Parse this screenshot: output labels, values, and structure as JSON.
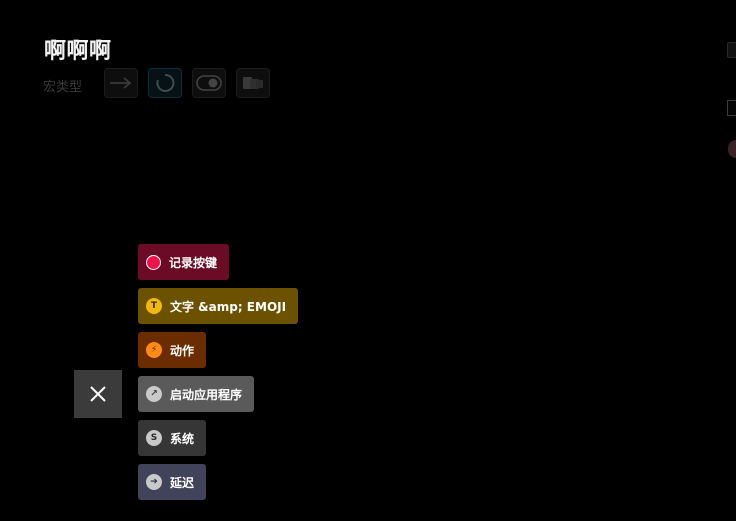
{
  "header": {
    "title": "啊啊啊",
    "macro_type_label": "宏类型",
    "type_buttons": [
      {
        "name": "arrow-right-icon",
        "active": false
      },
      {
        "name": "loop-icon",
        "active": true
      },
      {
        "name": "toggle-icon",
        "active": false
      },
      {
        "name": "cards-icon",
        "active": false
      }
    ]
  },
  "fab": {
    "close_icon": "close-icon"
  },
  "actions": [
    {
      "label": "记录按键",
      "icon": "record-icon",
      "color": "#6b0b25"
    },
    {
      "label": "文字 &amp; EMOJI",
      "icon": "text-icon",
      "icon_glyph": "T",
      "color": "#6b5100"
    },
    {
      "label": "动作",
      "icon": "lightning-icon",
      "icon_glyph": "⚡",
      "color": "#6b2d00"
    },
    {
      "label": "启动应用程序",
      "icon": "launch-app-icon",
      "icon_glyph": "↗",
      "color": "#5a5a5a"
    },
    {
      "label": "系统",
      "icon": "system-icon",
      "icon_glyph": "S",
      "color": "#363636"
    },
    {
      "label": "延迟",
      "icon": "delay-icon",
      "icon_glyph": "➔",
      "color": "#40435a"
    }
  ]
}
